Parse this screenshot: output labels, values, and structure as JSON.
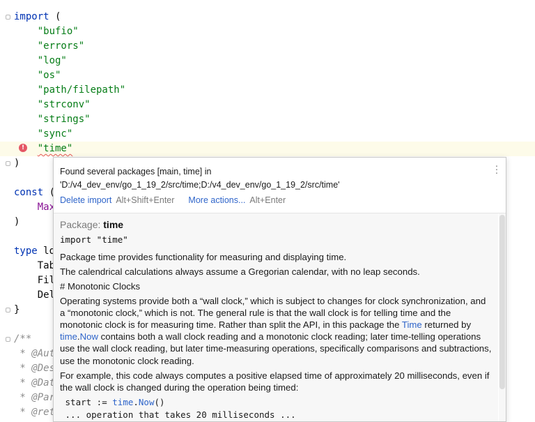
{
  "editor": {
    "lines": [
      {
        "t": 14,
        "fold": true,
        "parts": [
          {
            "c": "kw",
            "v": "import"
          },
          {
            "c": "",
            "v": " ("
          }
        ]
      },
      {
        "t": 35,
        "parts": [
          {
            "c": "",
            "v": "    "
          },
          {
            "c": "str",
            "v": "\"bufio\""
          }
        ]
      },
      {
        "t": 56,
        "parts": [
          {
            "c": "",
            "v": "    "
          },
          {
            "c": "str",
            "v": "\"errors\""
          }
        ]
      },
      {
        "t": 77,
        "parts": [
          {
            "c": "",
            "v": "    "
          },
          {
            "c": "str",
            "v": "\"log\""
          }
        ]
      },
      {
        "t": 98,
        "parts": [
          {
            "c": "",
            "v": "    "
          },
          {
            "c": "str",
            "v": "\"os\""
          }
        ]
      },
      {
        "t": 119,
        "parts": [
          {
            "c": "",
            "v": "    "
          },
          {
            "c": "str",
            "v": "\"path/filepath\""
          }
        ]
      },
      {
        "t": 140,
        "parts": [
          {
            "c": "",
            "v": "    "
          },
          {
            "c": "str",
            "v": "\"strconv\""
          }
        ]
      },
      {
        "t": 161,
        "parts": [
          {
            "c": "",
            "v": "    "
          },
          {
            "c": "str",
            "v": "\"strings\""
          }
        ]
      },
      {
        "t": 182,
        "parts": [
          {
            "c": "",
            "v": "    "
          },
          {
            "c": "str",
            "v": "\"sync\""
          }
        ]
      },
      {
        "t": 203,
        "hl": true,
        "error": true,
        "parts": [
          {
            "c": "",
            "v": "    "
          },
          {
            "c": "str err",
            "v": "\"time\""
          }
        ]
      },
      {
        "t": 224,
        "fold": true,
        "parts": [
          {
            "c": "",
            "v": ")"
          }
        ]
      },
      {
        "t": 266,
        "parts": [
          {
            "c": "kw",
            "v": "const"
          },
          {
            "c": "",
            "v": " ("
          }
        ]
      },
      {
        "t": 287,
        "parts": [
          {
            "c": "",
            "v": "    "
          },
          {
            "c": "const",
            "v": "Max"
          }
        ]
      },
      {
        "t": 308,
        "parts": [
          {
            "c": "",
            "v": ")"
          }
        ]
      },
      {
        "t": 350,
        "parts": [
          {
            "c": "kw",
            "v": "type"
          },
          {
            "c": "",
            "v": " lo"
          }
        ]
      },
      {
        "t": 371,
        "parts": [
          {
            "c": "",
            "v": "    Tab"
          }
        ]
      },
      {
        "t": 392,
        "parts": [
          {
            "c": "",
            "v": "    Fil"
          }
        ]
      },
      {
        "t": 413,
        "parts": [
          {
            "c": "",
            "v": "    Del"
          }
        ]
      },
      {
        "t": 434,
        "fold": true,
        "parts": [
          {
            "c": "",
            "v": "}"
          }
        ]
      },
      {
        "t": 476,
        "fold": true,
        "parts": [
          {
            "c": "cmt",
            "v": "/**"
          }
        ]
      },
      {
        "t": 497,
        "parts": [
          {
            "c": "cmt",
            "v": " * @Auth"
          }
        ]
      },
      {
        "t": 518,
        "parts": [
          {
            "c": "cmt",
            "v": " * @Desc"
          }
        ]
      },
      {
        "t": 539,
        "parts": [
          {
            "c": "cmt",
            "v": " * @Date"
          }
        ]
      },
      {
        "t": 560,
        "parts": [
          {
            "c": "cmt",
            "v": " * @Para"
          }
        ]
      },
      {
        "t": 581,
        "parts": [
          {
            "c": "cmt",
            "v": " * @retu"
          }
        ]
      }
    ]
  },
  "popup": {
    "message": "Found several packages [main, time] in 'D:/v4_dev_env/go_1_19_2/src/time;D:/v4_dev_env/go_1_19_2/src/time'",
    "actions": {
      "delete_label": "Delete import",
      "delete_shortcut": "Alt+Shift+Enter",
      "more_label": "More actions...",
      "more_shortcut": "Alt+Enter"
    },
    "doc": {
      "package_label": "Package:",
      "package_name": "time",
      "import_line": "import \"time\"",
      "p1": "Package time provides functionality for measuring and displaying time.",
      "p2": "The calendrical calculations always assume a Gregorian calendar, with no leap seconds.",
      "heading": "# Monotonic Clocks",
      "p3_a": "Operating systems provide both a “wall clock,” which is subject to changes for clock synchronization, and a “monotonic clock,” which is not. The general rule is that the wall clock is for telling time and the monotonic clock is for measuring time. Rather than split the API, in this package the ",
      "p3_link1": "Time",
      "p3_b": " returned by ",
      "p3_link2a": "time",
      "p3_dot": ".",
      "p3_link2b": "Now",
      "p3_c": " contains both a wall clock reading and a monotonic clock reading; later time-telling operations use the wall clock reading, but later time-measuring operations, specifically comparisons and subtractions, use the monotonic clock reading.",
      "p4": "For example, this code always computes a positive elapsed time of approximately 20 milliseconds, even if the wall clock is changed during the operation being timed:",
      "code1_a": " start := ",
      "code1_fn": "time",
      "code1_dot": ".",
      "code1_fn2": "Now",
      "code1_b": "()",
      "code2": " ... operation that takes 20 milliseconds ..."
    }
  }
}
